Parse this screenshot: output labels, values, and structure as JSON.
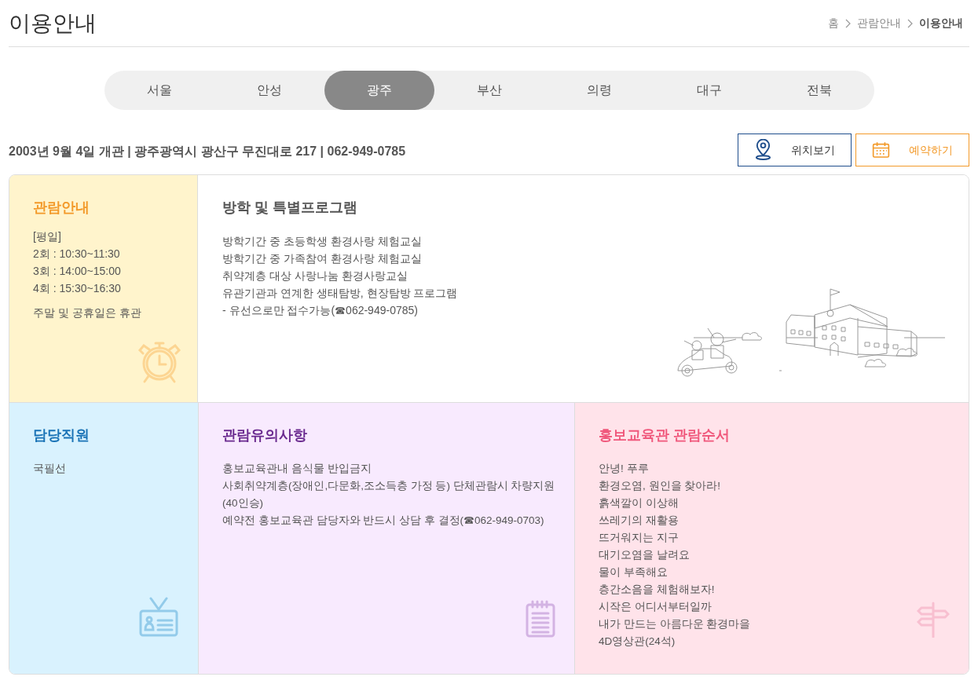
{
  "page_title": "이용안내",
  "breadcrumb": [
    {
      "label": "홈",
      "current": false
    },
    {
      "label": "관람안내",
      "current": false
    },
    {
      "label": "이용안내",
      "current": true
    }
  ],
  "tabs": [
    {
      "label": "서울",
      "selected": false
    },
    {
      "label": "안성",
      "selected": false
    },
    {
      "label": "광주",
      "selected": true
    },
    {
      "label": "부산",
      "selected": false
    },
    {
      "label": "의령",
      "selected": false
    },
    {
      "label": "대구",
      "selected": false
    },
    {
      "label": "전북",
      "selected": false
    }
  ],
  "info_line": "2003년 9월 4일 개관 | 광주광역시 광산구 무진대로 217 | 062-949-0785",
  "buttons": [
    {
      "kind": "location",
      "label": "위치보기"
    },
    {
      "kind": "reserve",
      "label": "예약하기"
    }
  ],
  "hours": {
    "title": "관람안내",
    "lines": [
      "[평일]",
      "2회 : 10:30~11:30",
      "3회 : 14:00~15:00",
      "4회 : 15:30~16:30"
    ],
    "note": "주말 및 공휴일은 휴관"
  },
  "program": {
    "title": "방학 및 특별프로그램",
    "lines": [
      "방학기간 중 초등학생 환경사랑 체험교실",
      "방학기간 중 가족참여 환경사랑 체험교실",
      "취약계층 대상 사랑나눔 환경사랑교실",
      "유관기관과 연계한 생태탐방, 현장탐방 프로그램",
      "- 유선으로만 접수가능(☎062-949-0785)"
    ]
  },
  "panels": [
    {
      "kind": "staff",
      "title": "담당직원",
      "lines": [
        "국필선"
      ]
    },
    {
      "kind": "notice",
      "title": "관람유의사항",
      "lines": [
        "홍보교육관내 음식물 반입금지",
        "사회취약계층(장애인,다문화,조소득층 가정 등) 단체관람시 차량지원 (40인승)",
        "예약전 홍보교육관 담당자와 반드시 상담 후 결정(☎062-949-0703)"
      ]
    },
    {
      "kind": "order",
      "title": "홍보교육관 관람순서",
      "lines": [
        "안녕! 푸루",
        "환경오염, 원인을 찾아라!",
        "흙색깔이 이상해",
        "쓰레기의 재활용",
        "뜨거워지는 지구",
        "대기오염을 날려요",
        "물이 부족해요",
        "층간소음을 체험해보자!",
        "시작은 어디서부터일까",
        "내가 만드는 아름다운 환경마을",
        "4D영상관(24석)"
      ]
    }
  ]
}
